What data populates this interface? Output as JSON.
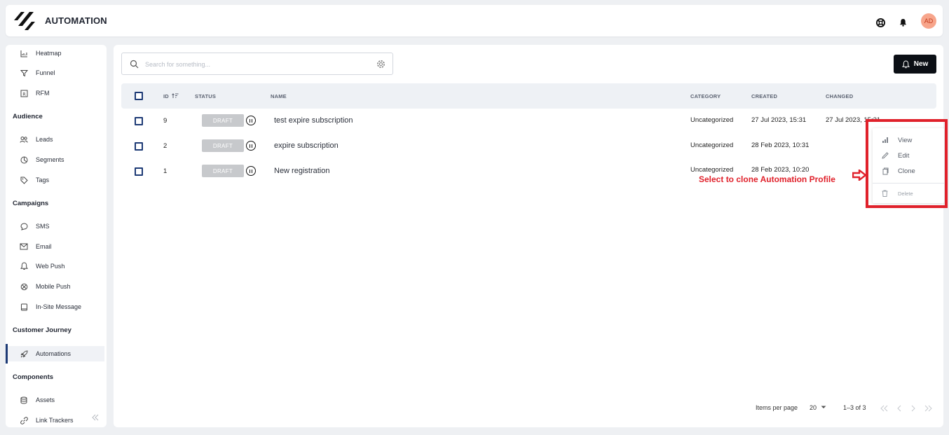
{
  "header": {
    "title": "AUTOMATION",
    "avatar_initials": "AD",
    "icons": [
      "help-icon",
      "bell-icon"
    ]
  },
  "sidebar": {
    "items_top": [
      {
        "label": "Heatmap",
        "icon": "heatmap-icon"
      },
      {
        "label": "Funnel",
        "icon": "funnel-icon"
      },
      {
        "label": "RFM",
        "icon": "rfm-icon"
      }
    ],
    "sections": [
      {
        "title": "Audience",
        "items": [
          {
            "label": "Leads",
            "icon": "users-icon"
          },
          {
            "label": "Segments",
            "icon": "pie-icon"
          },
          {
            "label": "Tags",
            "icon": "tag-icon"
          }
        ]
      },
      {
        "title": "Campaigns",
        "items": [
          {
            "label": "SMS",
            "icon": "chat-icon"
          },
          {
            "label": "Email",
            "icon": "mail-icon"
          },
          {
            "label": "Web Push",
            "icon": "bell-icon"
          },
          {
            "label": "Mobile Push",
            "icon": "mobile-icon"
          },
          {
            "label": "In-Site Message",
            "icon": "message-icon"
          }
        ]
      },
      {
        "title": "Customer Journey",
        "items": [
          {
            "label": "Automations",
            "icon": "rocket-icon",
            "active": true
          }
        ]
      },
      {
        "title": "Components",
        "items": [
          {
            "label": "Assets",
            "icon": "database-icon"
          },
          {
            "label": "Link Trackers",
            "icon": "link-icon"
          }
        ]
      }
    ]
  },
  "toolbar": {
    "search_placeholder": "Search for something...",
    "new_label": "New"
  },
  "table": {
    "columns": {
      "id": "ID",
      "status": "STATUS",
      "name": "NAME",
      "category": "CATEGORY",
      "created": "CREATED",
      "changed": "CHANGED"
    },
    "rows": [
      {
        "id": "9",
        "status": "DRAFT",
        "name": "test expire subscription",
        "category": "Uncategorized",
        "created": "27 Jul 2023, 15:31",
        "changed": "27 Jul 2023, 15:31"
      },
      {
        "id": "2",
        "status": "DRAFT",
        "name": "expire subscription",
        "category": "Uncategorized",
        "created": "28 Feb 2023, 10:31",
        "changed": ""
      },
      {
        "id": "1",
        "status": "DRAFT",
        "name": "New registration",
        "category": "Uncategorized",
        "created": "28 Feb 2023, 10:20",
        "changed": ""
      }
    ]
  },
  "context_menu": {
    "view": "View",
    "edit": "Edit",
    "clone": "Clone",
    "delete": "Delete"
  },
  "annotation": {
    "text": "Select to clone Automation Profile",
    "color": "#e0212b"
  },
  "pagination": {
    "items_per_page_label": "Items per page",
    "items_per_page_value": "20",
    "range": "1–3 of 3"
  }
}
